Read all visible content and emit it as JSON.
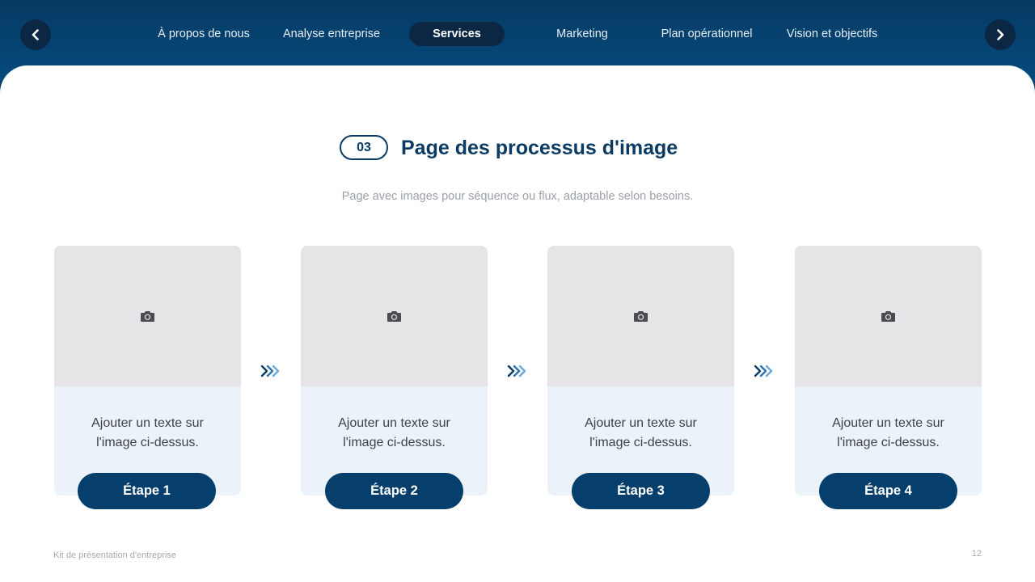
{
  "nav": {
    "tabs": [
      {
        "label": "À propos de nous"
      },
      {
        "label": "Analyse entreprise"
      },
      {
        "label": "Services"
      },
      {
        "label": "Marketing"
      },
      {
        "label": "Plan opérationnel"
      },
      {
        "label": "Vision et objectifs"
      }
    ],
    "active_tab": "Services",
    "prev_icon": "chevron-left-icon",
    "next_icon": "chevron-right-icon"
  },
  "header": {
    "number": "03",
    "title": "Page des processus d'image",
    "subtitle": "Page avec images pour séquence ou flux, adaptable selon besoins."
  },
  "steps": [
    {
      "image_icon": "camera-icon",
      "text_line1": "Ajouter un texte sur",
      "text_line2": "l'image ci-dessus.",
      "button": "Étape 1"
    },
    {
      "image_icon": "camera-icon",
      "text_line1": "Ajouter un texte sur",
      "text_line2": "l'image ci-dessus.",
      "button": "Étape 2"
    },
    {
      "image_icon": "camera-icon",
      "text_line1": "Ajouter un texte sur",
      "text_line2": "l'image ci-dessus.",
      "button": "Étape 3"
    },
    {
      "image_icon": "camera-icon",
      "text_line1": "Ajouter un texte sur",
      "text_line2": "l'image ci-dessus.",
      "button": "Étape 4"
    }
  ],
  "footer": {
    "left": "Kit de présentation d'entreprise",
    "page_number": "12"
  },
  "colors": {
    "primary": "#063f6b",
    "pill_dark": "#0b2744",
    "card_bg": "#ecf2f9",
    "image_bg": "#e6e4e6",
    "chevron_light": "#6aa9dc"
  }
}
